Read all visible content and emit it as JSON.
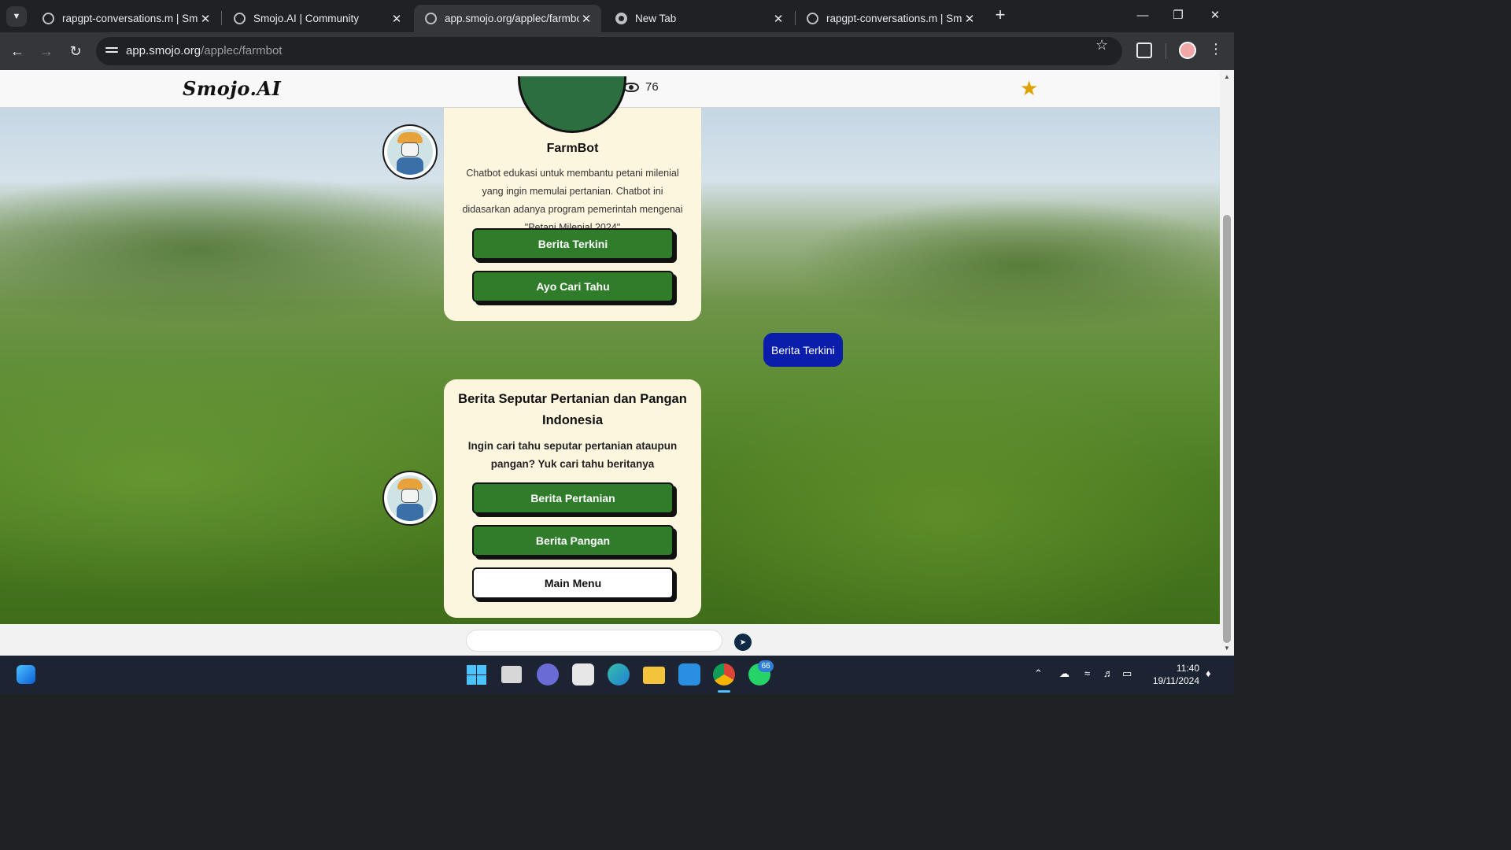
{
  "browser": {
    "tabs": [
      {
        "title": "rapgpt-conversations.m | Smojo",
        "active": false
      },
      {
        "title": "Smojo.AI | Community",
        "active": false
      },
      {
        "title": "app.smojo.org/applec/farmbot",
        "active": true
      },
      {
        "title": "New Tab",
        "active": false
      },
      {
        "title": "rapgpt-conversations.m | Smojo",
        "active": false
      }
    ],
    "new_tab_label": "+",
    "url_host": "app.smojo.org",
    "url_path": "/applec/farmbot"
  },
  "site": {
    "logo_text": "Smojo.AI",
    "view_count": "76",
    "accent_color": "#2f7d2b",
    "favorite_color": "#e0a100"
  },
  "chat": {
    "intro_card": {
      "bot_name": "FarmBot",
      "description": "Chatbot edukasi untuk membantu petani milenial yang ingin memulai pertanian. Chatbot ini didasarkan adanya program pemerintah mengenai \"Petani Milenial 2024\"",
      "buttons": [
        "Berita Terkini",
        "Ayo Cari Tahu"
      ]
    },
    "user_message": "Berita Terkini",
    "news_card": {
      "title": "Berita Seputar Pertanian dan Pangan Indonesia",
      "subtitle": "Ingin cari tahu seputar pertanian ataupun pangan? Yuk cari tahu beritanya",
      "buttons": [
        "Berita Pertanian",
        "Berita Pangan",
        "Main Menu"
      ]
    },
    "input_value": "",
    "send_icon": "send-icon"
  },
  "taskbar": {
    "badge_count": "66",
    "time": "11:40",
    "date": "19/11/2024"
  }
}
